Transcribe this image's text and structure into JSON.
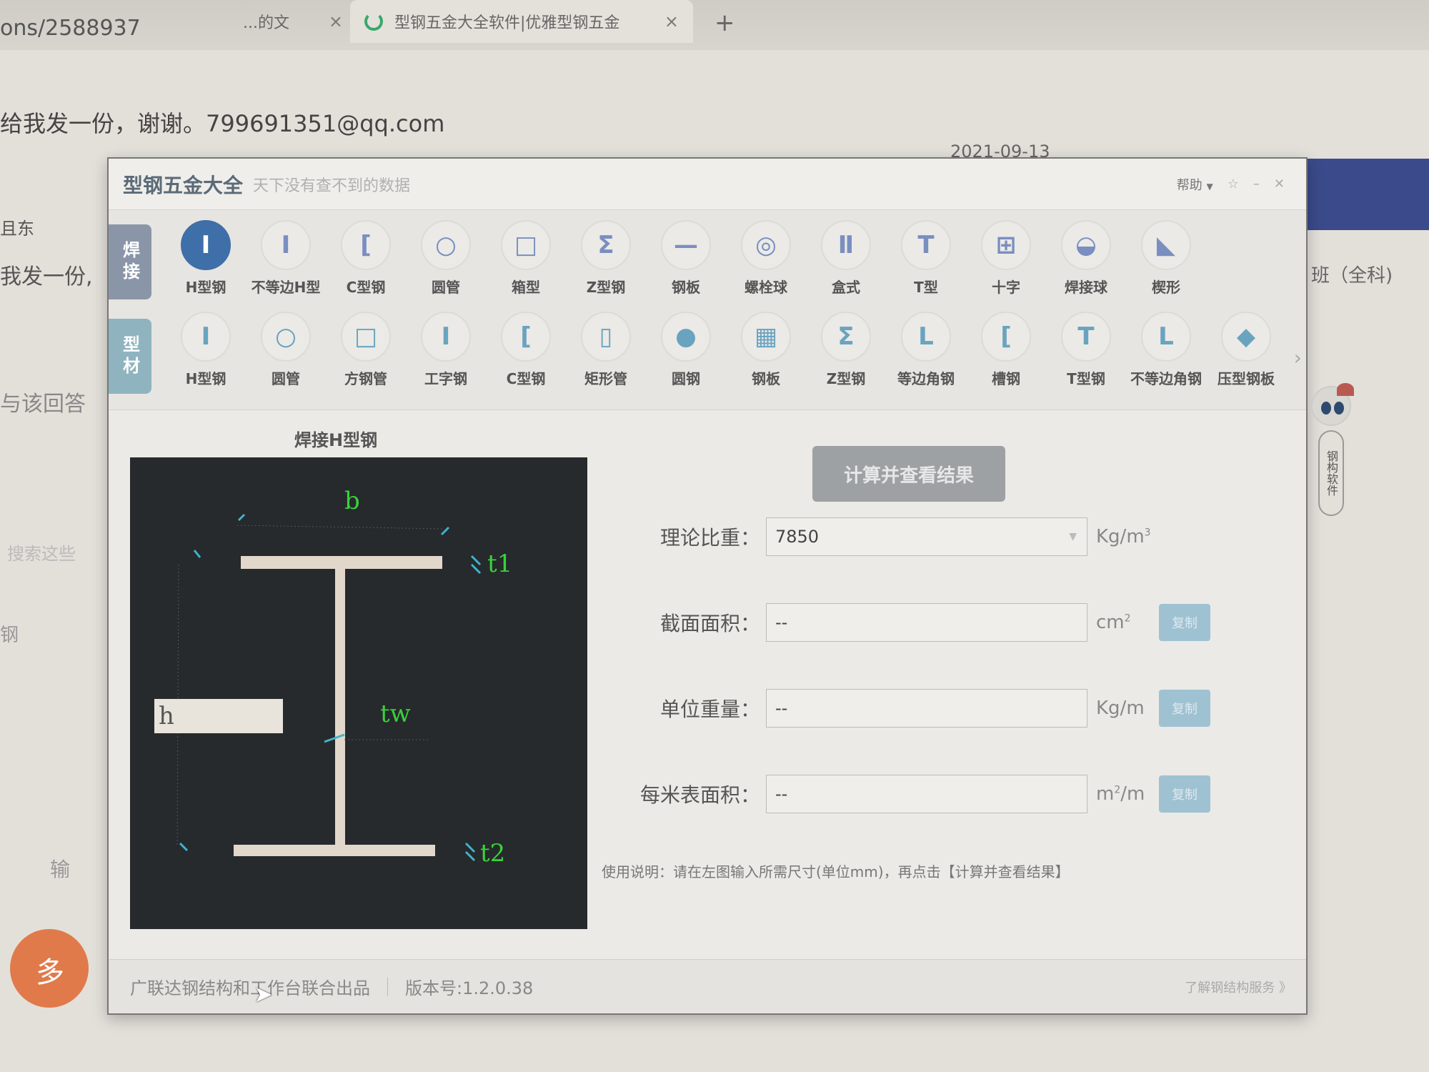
{
  "browser": {
    "url_fragment": "ons/2588937",
    "prev_tab_label": "...的文",
    "active_tab_label": "型钢五金大全软件|优雅型钢五金",
    "close_glyph": "×",
    "new_tab_glyph": "+"
  },
  "background_page": {
    "email_line": "给我发一份，谢谢。799691351@qq.com",
    "date": "2021-09-13",
    "line1": "且东",
    "line2": "我发一份,",
    "line3": "与该回答",
    "line4": "搜索这些",
    "line5": "钢",
    "line6": "输",
    "banner_pill": "全科",
    "right_text": "班（全科)",
    "orange_badge": "多"
  },
  "app": {
    "title": "型钢五金大全",
    "slogan": "天下没有查不到的数据",
    "help_label": "帮助",
    "window_controls": [
      "☆",
      "–",
      "✕"
    ],
    "categories": [
      {
        "label": "焊接",
        "active": true
      },
      {
        "label": "型材",
        "active": false
      }
    ],
    "weld_shapes": [
      {
        "label": "H型钢",
        "glyph": "I",
        "icon": "h-beam-icon",
        "active": true
      },
      {
        "label": "不等边H型",
        "glyph": "I",
        "icon": "unequal-h-beam-icon"
      },
      {
        "label": "C型钢",
        "glyph": "[",
        "icon": "c-channel-icon"
      },
      {
        "label": "圆管",
        "glyph": "○",
        "icon": "round-tube-icon"
      },
      {
        "label": "箱型",
        "glyph": "□",
        "icon": "box-section-icon"
      },
      {
        "label": "Z型钢",
        "glyph": "Ʃ",
        "icon": "z-section-icon"
      },
      {
        "label": "钢板",
        "glyph": "—",
        "icon": "steel-plate-icon"
      },
      {
        "label": "螺栓球",
        "glyph": "◎",
        "icon": "bolt-ball-icon"
      },
      {
        "label": "盒式",
        "glyph": "Ⅱ",
        "icon": "box-type-icon"
      },
      {
        "label": "T型",
        "glyph": "T",
        "icon": "t-section-icon"
      },
      {
        "label": "十字",
        "glyph": "⊞",
        "icon": "cross-section-icon"
      },
      {
        "label": "焊接球",
        "glyph": "◒",
        "icon": "welded-ball-icon"
      },
      {
        "label": "楔形",
        "glyph": "◣",
        "icon": "wedge-icon"
      }
    ],
    "profile_shapes": [
      {
        "label": "H型钢",
        "glyph": "I",
        "icon": "h-beam-icon"
      },
      {
        "label": "圆管",
        "glyph": "○",
        "icon": "round-tube-icon"
      },
      {
        "label": "方钢管",
        "glyph": "□",
        "icon": "square-tube-icon"
      },
      {
        "label": "工字钢",
        "glyph": "I",
        "icon": "i-beam-icon"
      },
      {
        "label": "C型钢",
        "glyph": "[",
        "icon": "c-channel-icon"
      },
      {
        "label": "矩形管",
        "glyph": "▯",
        "icon": "rect-tube-icon"
      },
      {
        "label": "圆钢",
        "glyph": "●",
        "icon": "round-bar-icon"
      },
      {
        "label": "钢板",
        "glyph": "▦",
        "icon": "steel-plate-icon"
      },
      {
        "label": "Z型钢",
        "glyph": "Ʃ",
        "icon": "z-section-icon"
      },
      {
        "label": "等边角钢",
        "glyph": "L",
        "icon": "equal-angle-icon"
      },
      {
        "label": "槽钢",
        "glyph": "[",
        "icon": "channel-icon"
      },
      {
        "label": "T型钢",
        "glyph": "T",
        "icon": "t-section-icon"
      },
      {
        "label": "不等边角钢",
        "glyph": "L",
        "icon": "unequal-angle-icon"
      },
      {
        "label": "压型钢板",
        "glyph": "◆",
        "icon": "profiled-sheet-icon"
      }
    ],
    "next_arrow": "›",
    "diagram": {
      "title": "焊接H型钢",
      "labels": {
        "b": "b",
        "t1": "t1",
        "tw": "tw",
        "t2": "t2"
      },
      "h_input_value": "h"
    },
    "calc_button": "计算并查看结果",
    "form": {
      "density": {
        "label": "理论比重：",
        "value": "7850",
        "unit": "Kg/m",
        "unit_sup": "3"
      },
      "area": {
        "label": "截面面积：",
        "value": "--",
        "unit": "cm",
        "unit_sup": "2",
        "copy": "复制"
      },
      "weight": {
        "label": "单位重量：",
        "value": "--",
        "unit": "Kg/m",
        "copy": "复制"
      },
      "surface": {
        "label": "每米表面积：",
        "value": "--",
        "unit": "m",
        "unit_sup": "2",
        "unit_tail": "/m",
        "copy": "复制"
      }
    },
    "usage_note": "使用说明：请在左图输入所需尺寸(单位mm)，再点击【计算并查看结果】",
    "footer": {
      "publisher": "广联达钢结构和工作台联合出品",
      "version": "版本号:1.2.0.38",
      "learn_link": "了解钢结构服务 》"
    },
    "mascot_label": "钢构软件"
  }
}
